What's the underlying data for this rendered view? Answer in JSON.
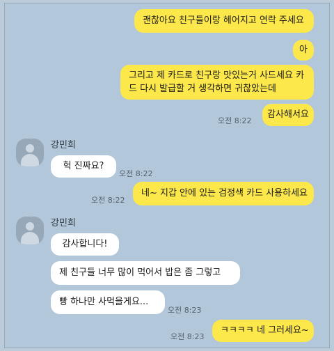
{
  "messages": {
    "m1": "괜찮아요 친구들이랑 헤어지고 연락 주세요",
    "m2": "아",
    "m3_line1": "그리고 제 카드로 친구랑 맛있는거 사드세요 카",
    "m3_line2": "드 다시 발급할 거 생각하면 귀찮았는데",
    "m4": "감사해서요",
    "m4_time": "오전 8:22",
    "sender1": "강민희",
    "r1": "헉 진짜요?",
    "r1_time": "오전 8:22",
    "m5": "네~ 지갑 안에 있는 검정색 카드 사용하세요",
    "m5_time": "오전 8:22",
    "sender2": "강민희",
    "r2": "감사합니다!",
    "r3": "제 친구들 너무 많이 먹어서 밥은 좀 그렇고",
    "r4": "빵 하나만 사먹을게요...",
    "r4_time": "오전 8:23",
    "m6": "ㅋㅋㅋㅋ 네 그러세요~",
    "m6_time": "오전 8:23"
  },
  "colors": {
    "background": "#b2c7da",
    "my_bubble": "#fde84b",
    "their_bubble": "#ffffff"
  }
}
